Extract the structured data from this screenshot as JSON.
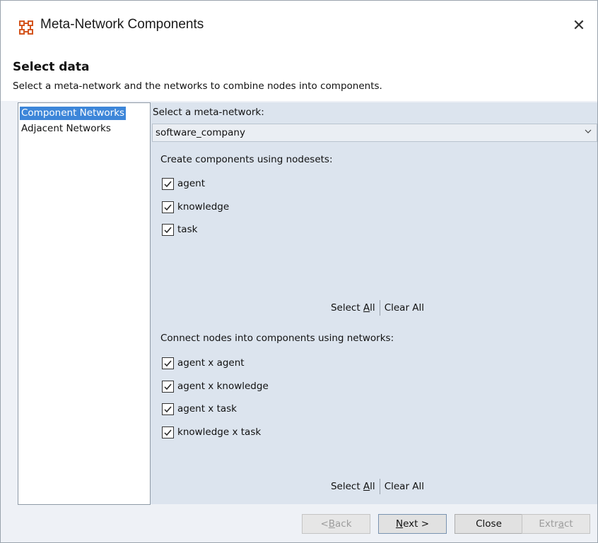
{
  "window": {
    "title": "Meta-Network Components",
    "close_glyph": "✕",
    "icon": "app-network-icon",
    "icon_color": "#d4551e"
  },
  "header": {
    "title": "Select data",
    "description": "Select a meta-network and the networks to combine nodes into components."
  },
  "sidebar": {
    "items": [
      {
        "label": "Component Networks",
        "selected": true
      },
      {
        "label": "Adjacent Networks",
        "selected": false
      }
    ],
    "selected_color": "#3d86d9"
  },
  "main": {
    "meta_network_label": "Select a meta-network:",
    "meta_network_value": "software_company",
    "nodesets": {
      "label": "Create components using nodesets:",
      "items": [
        {
          "label": "agent",
          "checked": true
        },
        {
          "label": "knowledge",
          "checked": true
        },
        {
          "label": "task",
          "checked": true
        }
      ],
      "select_all_prefix": "Select ",
      "select_all_mnemonic": "A",
      "select_all_suffix": "ll",
      "clear_all": "Clear All"
    },
    "networks": {
      "label": "Connect nodes into components using networks:",
      "items": [
        {
          "label": "agent x agent",
          "checked": true
        },
        {
          "label": "agent x knowledge",
          "checked": true
        },
        {
          "label": "agent x task",
          "checked": true
        },
        {
          "label": "knowledge x task",
          "checked": true
        }
      ],
      "select_all_prefix": "Select ",
      "select_all_mnemonic": "A",
      "select_all_suffix": "ll",
      "clear_all": "Clear All"
    }
  },
  "buttons": {
    "back": {
      "prefix": "< ",
      "mnemonic": "B",
      "suffix": "ack",
      "enabled": false
    },
    "next": {
      "prefix": "",
      "mnemonic": "N",
      "suffix": "ext >",
      "enabled": true
    },
    "close": {
      "label": "Close",
      "enabled": true
    },
    "extract": {
      "prefix": "Extr",
      "mnemonic": "a",
      "suffix": "ct",
      "enabled": false
    }
  }
}
